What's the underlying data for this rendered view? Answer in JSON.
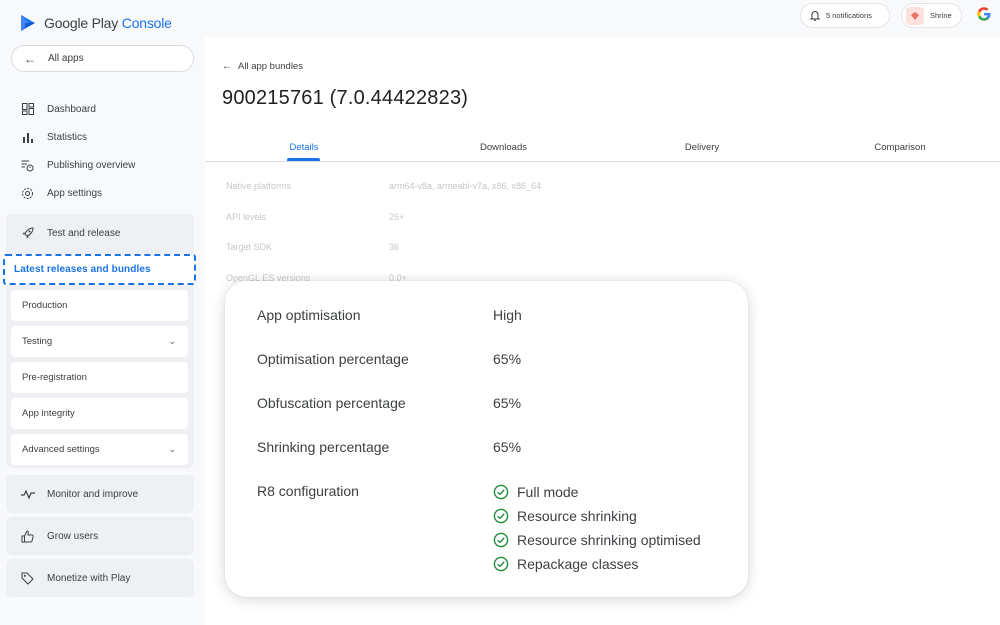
{
  "app": {
    "brand_prefix": "Google Play",
    "brand_suffix": "Console",
    "all_apps": "All apps"
  },
  "nav": {
    "items": [
      {
        "label": "Dashboard",
        "icon": "dashboard-icon"
      },
      {
        "label": "Statistics",
        "icon": "bar-chart-icon"
      },
      {
        "label": "Publishing overview",
        "icon": "publishing-icon"
      },
      {
        "label": "App settings",
        "icon": "gear-icon"
      }
    ],
    "test_release": {
      "label": "Test and release",
      "icon": "rocket-icon",
      "highlighted": "Latest releases and bundles",
      "subitems": [
        {
          "label": "Production",
          "expandable": false
        },
        {
          "label": "Testing",
          "expandable": true
        },
        {
          "label": "Pre-registration",
          "expandable": false
        },
        {
          "label": "App integrity",
          "expandable": false
        },
        {
          "label": "Advanced settings",
          "expandable": true
        }
      ]
    },
    "groups": [
      {
        "label": "Monitor and improve",
        "icon": "pulse-icon"
      },
      {
        "label": "Grow users",
        "icon": "thumbs-up-icon"
      },
      {
        "label": "Monetize with Play",
        "icon": "tag-icon"
      }
    ]
  },
  "topbar": {
    "notifications": "5 notifications",
    "account": "Shrine"
  },
  "main": {
    "back_label": "All app bundles",
    "title": "900215761 (7.0.44422823)",
    "tabs": [
      "Details",
      "Downloads",
      "Delivery",
      "Comparison"
    ],
    "active_tab": "Details",
    "faint_rows": [
      {
        "label": "Native platforms",
        "value": "arm64-v8a, armeabi-v7a, x86, x86_64"
      },
      {
        "label": "API levels",
        "value": "26+"
      },
      {
        "label": "Target SDK",
        "value": "36"
      },
      {
        "label": "OpenGL ES versions",
        "value": "0.0+"
      }
    ]
  },
  "card": {
    "rows": [
      {
        "label": "App optimisation",
        "value": "High"
      },
      {
        "label": "Optimisation percentage",
        "value": "65%"
      },
      {
        "label": "Obfuscation percentage",
        "value": "65%"
      },
      {
        "label": "Shrinking percentage",
        "value": "65%"
      }
    ],
    "r8": {
      "label": "R8 configuration",
      "items": [
        "Full mode",
        "Resource shrinking",
        "Resource shrinking optimised",
        "Repackage classes"
      ]
    }
  },
  "colors": {
    "accent": "#1a73e8",
    "check": "#1e8e3e"
  }
}
